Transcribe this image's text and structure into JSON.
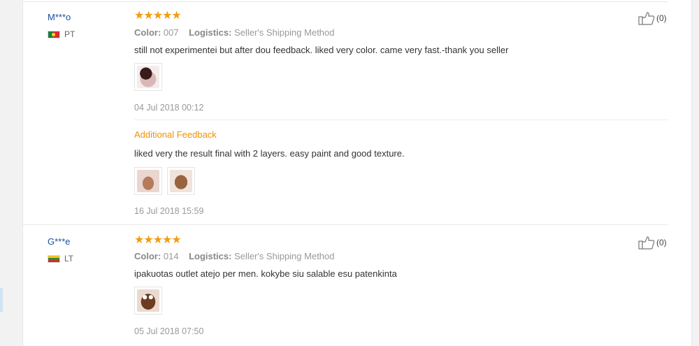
{
  "reviews": [
    {
      "user": "M***o",
      "country": "PT",
      "stars": "★★★★★",
      "color_label": "Color:",
      "color_value": "007",
      "logistics_label": "Logistics:",
      "logistics_value": "Seller's Shipping Method",
      "text": "still not experimentei but after dou feedback. liked very color. came very fast.-thank you seller",
      "date": "04 Jul 2018 00:12",
      "likes": "(0)",
      "additional": {
        "title": "Additional Feedback",
        "text": "liked very the result final with 2 layers. easy paint and good texture.",
        "date": "16 Jul 2018 15:59"
      }
    },
    {
      "user": "G***e",
      "country": "LT",
      "stars": "★★★★★",
      "color_label": "Color:",
      "color_value": "014",
      "logistics_label": "Logistics:",
      "logistics_value": "Seller's Shipping Method",
      "text": "ipakuotas outlet atejo per men. kokybe siu salable esu patenkinta",
      "date": "05 Jul 2018 07:50",
      "likes": "(0)"
    }
  ],
  "icons": {
    "like": "thumbs-up-icon"
  },
  "colors": {
    "username": "#1a4f9c",
    "stars": "#f39c12",
    "additional_title": "#f29100"
  }
}
